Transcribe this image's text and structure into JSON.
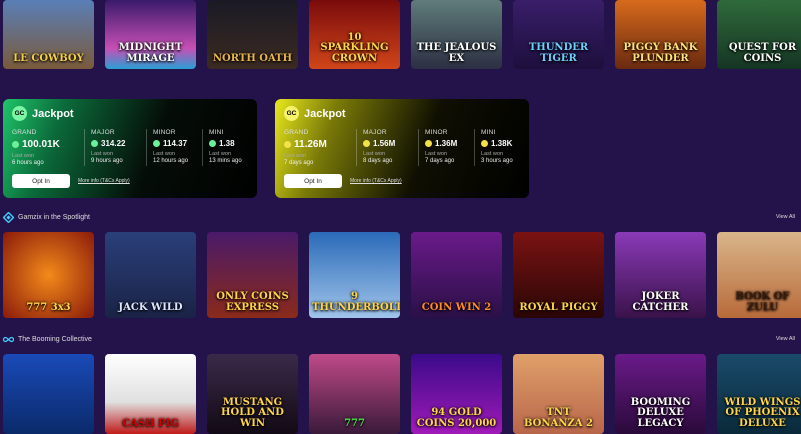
{
  "top_games": [
    {
      "title": "LE COWBOY",
      "bg": "linear-gradient(#5a7fb8,#7a5a3a)",
      "color": "#f6d04a"
    },
    {
      "title": "MIDNIGHT MIRAGE",
      "bg": "linear-gradient(#3a1a6a,#c64fb5 70%,#2a9fd4)",
      "color": "#ffffff"
    },
    {
      "title": "NORTH OATH",
      "bg": "linear-gradient(#1a1a24,#3b2a22)",
      "color": "#e8b64a"
    },
    {
      "title": "10 SPARKLING CROWN",
      "bg": "linear-gradient(#7a0b0b,#d1461a)",
      "color": "#ffd54a"
    },
    {
      "title": "THE JEALOUS EX",
      "bg": "linear-gradient(#5f7c7a,#2c2f42)",
      "color": "#ffffff"
    },
    {
      "title": "THUNDER TIGER",
      "bg": "linear-gradient(#3a1e6a,#1c0f3c)",
      "color": "#6ad1ff"
    },
    {
      "title": "PIGGY BANK PLUNDER",
      "bg": "linear-gradient(#d76a1c,#6a2a10)",
      "color": "#ffe27a"
    },
    {
      "title": "QUEST FOR COINS",
      "bg": "linear-gradient(#2f6a3a,#153524)",
      "color": "#ffffff"
    }
  ],
  "jackpots": [
    {
      "badge": "GC",
      "title": "Jackpot",
      "tiers": [
        {
          "label": "GRAND",
          "value": "100.01K",
          "last_won_label": "Last won",
          "last_won": "6 hours ago"
        },
        {
          "label": "MAJOR",
          "value": "314.22",
          "last_won_label": "Last won",
          "last_won": "9 hours ago"
        },
        {
          "label": "MINOR",
          "value": "114.37",
          "last_won_label": "Last won",
          "last_won": "12 hours ago"
        },
        {
          "label": "MINI",
          "value": "1.38",
          "last_won_label": "Last won",
          "last_won": "13 mins ago"
        }
      ],
      "opt_in": "Opt In",
      "more_info": "More info (T&Cs Apply)"
    },
    {
      "badge": "GC",
      "title": "Jackpot",
      "tiers": [
        {
          "label": "GRAND",
          "value": "11.26M",
          "last_won_label": "Last won",
          "last_won": "7 days ago"
        },
        {
          "label": "MAJOR",
          "value": "1.56M",
          "last_won_label": "Last won",
          "last_won": "8 days ago"
        },
        {
          "label": "MINOR",
          "value": "1.36M",
          "last_won_label": "Last won",
          "last_won": "7 days ago"
        },
        {
          "label": "MINI",
          "value": "1.38K",
          "last_won_label": "Last won",
          "last_won": "3 hours ago"
        }
      ],
      "opt_in": "Opt In",
      "more_info": "More info (T&Cs Apply)"
    }
  ],
  "spotlight": {
    "title": "Gamzix in the Spotlight",
    "view_all": "View All",
    "games": [
      {
        "title": "777 3x3",
        "bg": "radial-gradient(circle,#f38a1a,#8a1a0a)",
        "color": "#ffd54a"
      },
      {
        "title": "JACK WILD",
        "bg": "linear-gradient(#2a3f7a,#1a2346)",
        "color": "#dde6ff"
      },
      {
        "title": "ONLY COINS EXPRESS",
        "bg": "linear-gradient(#4a1a6a,#8a2a1a)",
        "color": "#ffd54a"
      },
      {
        "title": "9 THUNDERBOLTS",
        "bg": "linear-gradient(#2a6ab8,#a0c4ea)",
        "color": "#ffd54a"
      },
      {
        "title": "COIN WIN 2",
        "bg": "linear-gradient(#6a1a8a,#2a1046)",
        "color": "#ff8a2a"
      },
      {
        "title": "ROYAL PIGGY",
        "bg": "linear-gradient(#7a1212,#2a0606)",
        "color": "#ffd54a"
      },
      {
        "title": "JOKER CATCHER",
        "bg": "linear-gradient(#8a3ab8,#3a124a)",
        "color": "#ffffff"
      },
      {
        "title": "BOOK OF ZULU",
        "bg": "linear-gradient(#d9b68a,#b86a3a)",
        "color": "#3a1a0a"
      }
    ]
  },
  "booming": {
    "title": "The Booming Collective",
    "view_all": "View All",
    "games": [
      {
        "title": "",
        "bg": "linear-gradient(#1a4ab8,#0a2a6a)",
        "color": "#ffd54a"
      },
      {
        "title": "CASH PIG",
        "bg": "linear-gradient(#ffffff,#e0e0e0 60%,#c01a1a)",
        "color": "#d40000"
      },
      {
        "title": "MUSTANG HOLD AND WIN",
        "bg": "linear-gradient(#3a2a4a,#120a14)",
        "color": "#ffd54a"
      },
      {
        "title": "777",
        "bg": "linear-gradient(#c04a8a,#3a1a3a)",
        "color": "#4ae04a"
      },
      {
        "title": "94 GOLD COINS 20,000",
        "bg": "linear-gradient(#3a0a8a,#a01ab8)",
        "color": "#ffd54a"
      },
      {
        "title": "TNT BONANZA 2",
        "bg": "linear-gradient(#e0a06a,#b8664a)",
        "color": "#ffd54a"
      },
      {
        "title": "BOOMING DELUXE LEGACY",
        "bg": "linear-gradient(#6a1a8a,#2a0a3a)",
        "color": "#ffffff"
      },
      {
        "title": "WILD WINGS OF PHOENIX DELUXE",
        "bg": "linear-gradient(#1a4a6a,#0a2a3a)",
        "color": "#ffd54a"
      }
    ]
  }
}
